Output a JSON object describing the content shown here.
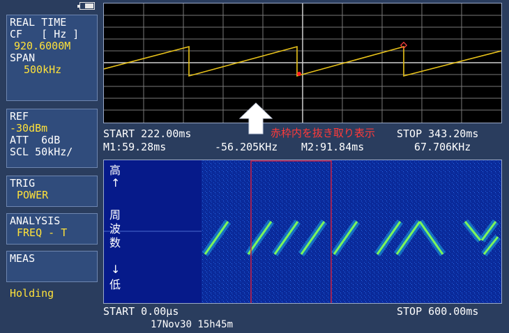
{
  "sidebar": {
    "realtime": {
      "l1": "REAL TIME",
      "l2": "CF   [ Hz ]",
      "l3": "920.6000M",
      "l4": "SPAN",
      "l5": "500kHz"
    },
    "ref": {
      "l1": "REF",
      "l2": "-30dBm",
      "l3": "ATT  6dB",
      "l4": "SCL 50kHz/"
    },
    "trig": {
      "l1": "TRIG",
      "l2": "POWER"
    },
    "analysis": {
      "l1": "ANALYSIS",
      "l2": "FREQ - T"
    },
    "meas": {
      "l1": "MEAS"
    },
    "status": "Holding"
  },
  "upper": {
    "start": "START 222.00ms",
    "stop": "STOP 343.20ms",
    "m1": "M1:59.28ms",
    "m1_value": "-56.205KHz",
    "m2": "M2:91.84ms",
    "m2_value": "67.706KHz",
    "annotation": "赤枠内を抜き取り表示"
  },
  "lower": {
    "y_high": "高",
    "y_up": "↑",
    "y_label_1": "周",
    "y_label_2": "波",
    "y_label_3": "数",
    "y_down": "↓",
    "y_low": "低",
    "start": "START 0.00µs",
    "stop": "STOP 600.00ms",
    "timestamp": "17Nov30 15h45m"
  },
  "colors": {
    "trace": "#e8c21a",
    "marker": "#ff2020",
    "selection": "#d02040"
  }
}
